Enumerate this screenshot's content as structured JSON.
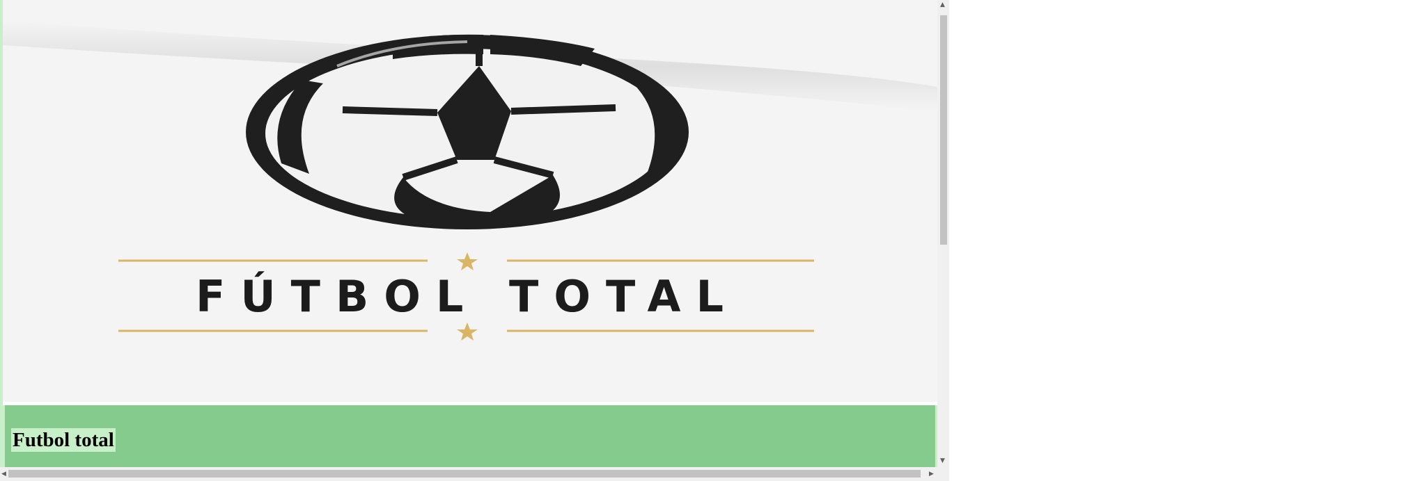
{
  "logo": {
    "text": "FÚTBOL TOTAL",
    "accent_color": "#d9b566",
    "ink_color": "#1c1c1c",
    "icon": "soccer-ball-icon"
  },
  "footer": {
    "site_name": "Futbol total",
    "background_color": "#86cb8e",
    "highlight_color": "#c8f0c8"
  },
  "scrollbars": {
    "up_arrow": "▲",
    "down_arrow": "▼",
    "left_arrow": "◀",
    "right_arrow": "▶"
  }
}
